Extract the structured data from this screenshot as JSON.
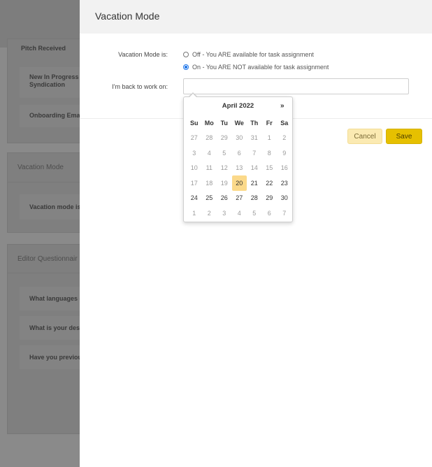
{
  "background": {
    "cards": [
      {
        "rows": [
          "Pitch Received",
          "New In Progress T Syndication",
          "Onboarding Emai"
        ]
      },
      {
        "title": "Vacation Mode",
        "rows": [
          "Vacation mode is"
        ]
      },
      {
        "title": "Editor Questionnair",
        "rows": [
          "What languages c",
          "What is your desi",
          "Have you previou"
        ]
      }
    ]
  },
  "modal": {
    "title": "Vacation Mode",
    "vacation_label": "Vacation Mode is:",
    "options": [
      {
        "label": "Off - You ARE available for task assignment",
        "checked": false
      },
      {
        "label": "On - You ARE NOT available for task assignment",
        "checked": true
      }
    ],
    "back_label": "I'm back to work on:",
    "date_value": "",
    "cancel_label": "Cancel",
    "save_label": "Save"
  },
  "datepicker": {
    "title": "April 2022",
    "next": "»",
    "weekdays": [
      "Su",
      "Mo",
      "Tu",
      "We",
      "Th",
      "Fr",
      "Sa"
    ],
    "weeks": [
      [
        {
          "d": "27",
          "m": true
        },
        {
          "d": "28",
          "m": true
        },
        {
          "d": "29",
          "m": true
        },
        {
          "d": "30",
          "m": true
        },
        {
          "d": "31",
          "m": true
        },
        {
          "d": "1",
          "m": true
        },
        {
          "d": "2",
          "m": true
        }
      ],
      [
        {
          "d": "3",
          "m": true
        },
        {
          "d": "4",
          "m": true
        },
        {
          "d": "5",
          "m": true
        },
        {
          "d": "6",
          "m": true
        },
        {
          "d": "7",
          "m": true
        },
        {
          "d": "8",
          "m": true
        },
        {
          "d": "9",
          "m": true
        }
      ],
      [
        {
          "d": "10",
          "m": true
        },
        {
          "d": "11",
          "m": true
        },
        {
          "d": "12",
          "m": true
        },
        {
          "d": "13",
          "m": true
        },
        {
          "d": "14",
          "m": true
        },
        {
          "d": "15",
          "m": true
        },
        {
          "d": "16",
          "m": true
        }
      ],
      [
        {
          "d": "17",
          "m": true
        },
        {
          "d": "18",
          "m": true
        },
        {
          "d": "19",
          "m": true
        },
        {
          "d": "20",
          "today": true
        },
        {
          "d": "21"
        },
        {
          "d": "22"
        },
        {
          "d": "23"
        }
      ],
      [
        {
          "d": "24"
        },
        {
          "d": "25"
        },
        {
          "d": "26"
        },
        {
          "d": "27"
        },
        {
          "d": "28"
        },
        {
          "d": "29"
        },
        {
          "d": "30"
        }
      ],
      [
        {
          "d": "1",
          "m": true
        },
        {
          "d": "2",
          "m": true
        },
        {
          "d": "3",
          "m": true
        },
        {
          "d": "4",
          "m": true
        },
        {
          "d": "5",
          "m": true
        },
        {
          "d": "6",
          "m": true
        },
        {
          "d": "7",
          "m": true
        }
      ]
    ]
  },
  "colors": {
    "accent": "#e6c000",
    "radio": "#1a73e8",
    "today": "#fbd98a"
  }
}
